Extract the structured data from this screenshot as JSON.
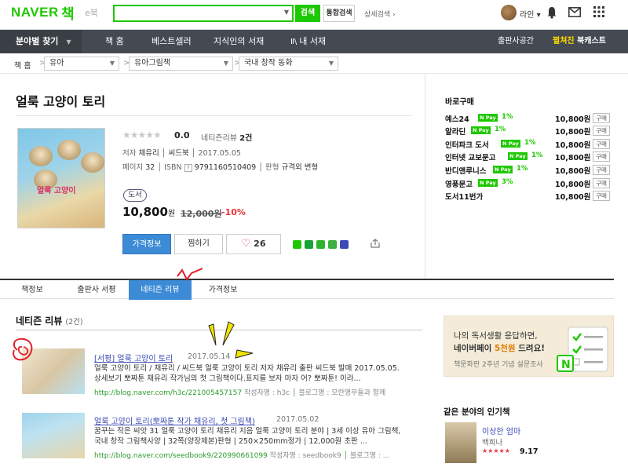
{
  "header": {
    "logo": "NAVER",
    "logo_book": "책",
    "ebook": "e북",
    "search_placeholder": "",
    "search_button": "검색",
    "total_search_button": "통합검색",
    "advanced_search": "상세검색",
    "user_name": "라인",
    "colors": {
      "brand": "#1ec800"
    }
  },
  "nav": {
    "category": "분야별 찾기",
    "items": [
      "책 홈",
      "베스트셀러",
      "지식인의 서재",
      "내 서재"
    ],
    "right1": "출판사공간",
    "right2_a": "펼쳐진",
    "right2_b": "북캐스트"
  },
  "breadcrumb": {
    "home": "책 홈",
    "levels": [
      "유아",
      "유아그림책",
      "국내 창작 동화"
    ]
  },
  "book": {
    "title": "얼룩 고양이 토리",
    "cover_text": "얼룩 고양이",
    "rating": "0.0",
    "review_label": "네티즌리뷰",
    "review_count": "2건",
    "author_label": "저자",
    "author": "채유리",
    "publisher": "씨드북",
    "pub_date": "2017.05.05",
    "pages_label": "페이지",
    "pages": "32",
    "isbn_label": "ISBN",
    "isbn": "9791160510409",
    "format_label": "판형",
    "format": "규격외 변형",
    "type_badge": "도서",
    "price": "10,800",
    "currency": "원",
    "original_price": "12,000원",
    "discount": "-10%",
    "price_button": "가격정보",
    "pick_button": "찜하기",
    "like_count": "26",
    "star_score": 0
  },
  "buy": {
    "title": "바로구매",
    "stores": [
      {
        "name": "예스24",
        "npay": "1%",
        "price": "10,800원"
      },
      {
        "name": "알라딘",
        "npay": "1%",
        "price": "10,800원"
      },
      {
        "name": "인터파크 도서",
        "npay": "1%",
        "price": "10,800원"
      },
      {
        "name": "인터넷 교보문고",
        "npay": "1%",
        "price": "10,800원"
      },
      {
        "name": "반디앤루니스",
        "npay": "1%",
        "price": "10,800원"
      },
      {
        "name": "영풍문고",
        "npay": "3%",
        "price": "10,800원"
      },
      {
        "name": "도서11번가",
        "npay": "",
        "price": "10,800원"
      }
    ],
    "npay_label": "N Pay",
    "buy_button": "구매"
  },
  "tabs": [
    "책정보",
    "출판사 서평",
    "네티즌 리뷰",
    "가격정보"
  ],
  "reviews": {
    "section_title": "네티즌 리뷰",
    "count": "(2건)",
    "items": [
      {
        "title": "[서평] 얼룩 고양이 토리",
        "date": "2017.05.14",
        "body": "얼룩 고양이 토리 / 채유리 / 씨드북 얼룩 고양이 토리 저자 채유리 출판 씨드북 발매 2017.05.05. 상세보기 뽀짜툰 채유리 작가님의 첫 그림책이다.표지를 보자 마자 어? 뽀짜툰! 이라...",
        "url": "http://blog.naver.com/h3c/221005457157",
        "writer_label": "작성자명 : h3c",
        "blog_label": "블로그명 : 모란명무들과 함께"
      },
      {
        "title": "얼룩 고양이 토리(뽀짜툰 작가 채유리, 첫 그림책)",
        "date": "2017.05.02",
        "body": "꿈꾸는 작은 씨앗 31 얼룩 고양이 토리 채유리 지음 얼룩 고양이 토리 분야 | 3세 이상 유아 그림책, 국내 창작 그림책사양 | 32쪽(양장제본)판형 | 250×250mm정가 | 12,000원 초판 ...",
        "url": "http://blog.naver.com/seedbook9/220990661099",
        "writer_label": "작성자명 : seedbook9",
        "blog_label": "블로그명 : ..."
      }
    ]
  },
  "ad": {
    "line1": "나의 독서생활 응답하면,",
    "line2_pre": "네이버페이 ",
    "line2_highlight": "5천원",
    "line2_post": " 드려요!",
    "line3": "책문화판 2주년 기념 설문조사"
  },
  "popular": {
    "title": "같은 분야의 인기책",
    "book_name": "이상한 엄마",
    "book_author": "백희나",
    "book_score": "9.17"
  }
}
